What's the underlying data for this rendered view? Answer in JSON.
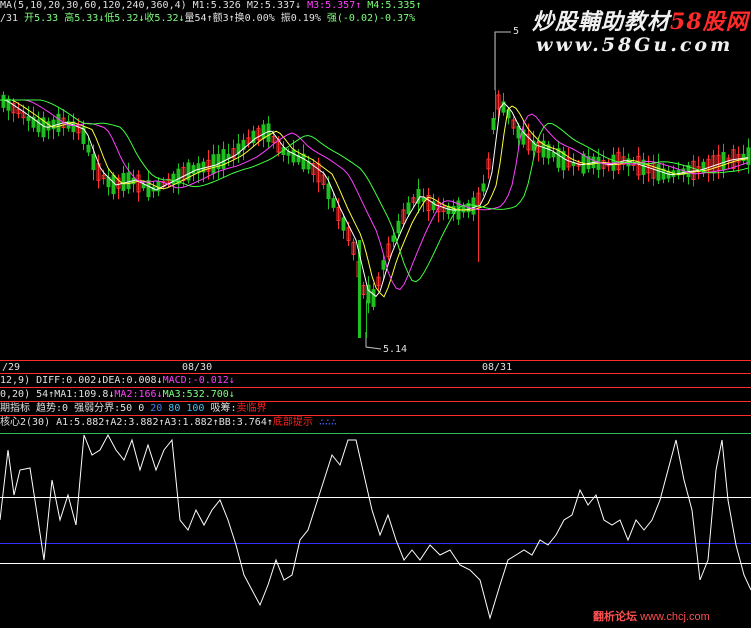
{
  "header": {
    "ma_line": [
      {
        "text": "MA(5,10,20,30,60,120,240,360,4) ",
        "color": "#e0e0e0"
      },
      {
        "text": "M1:5.326 ",
        "color": "#e0e0e0"
      },
      {
        "text": "M2:5.337↓ ",
        "color": "#e0e0e0"
      },
      {
        "text": "M3:5.357↑ ",
        "color": "#ff40ff"
      },
      {
        "text": "M4:5.335↑",
        "color": "#7cff7c"
      }
    ],
    "quote_line": [
      {
        "text": "/31 ",
        "color": "#e0e0e0"
      },
      {
        "text": "开5.33 ",
        "color": "#7cff7c"
      },
      {
        "text": "高5.33↓",
        "color": "#7cff7c"
      },
      {
        "text": "低5.32↓",
        "color": "#7cff7c"
      },
      {
        "text": "收5.32↓",
        "color": "#7cff7c"
      },
      {
        "text": "量54↑",
        "color": "#e0e0e0"
      },
      {
        "text": "额3↑",
        "color": "#e0e0e0"
      },
      {
        "text": "换0.00% ",
        "color": "#e0e0e0"
      },
      {
        "text": "振0.19% ",
        "color": "#e0e0e0"
      },
      {
        "text": "强(-0.02)-0.37%",
        "color": "#7cff7c"
      }
    ]
  },
  "watermark": {
    "brand_cn": "炒股輔助教材",
    "brand_58": "58股网",
    "url": "www.58Gu.com",
    "colors": {
      "brand_cn": "#f0f0f0",
      "brand_58": "#ff2a2a",
      "url": "#f0f0f0"
    }
  },
  "price_labels": {
    "high": "5",
    "low": "5.14"
  },
  "dates": [
    "/29",
    "08/30",
    "08/31"
  ],
  "indicators": [
    [
      {
        "text": " 12,9) ",
        "color": "#e0e0e0"
      },
      {
        "text": "DIFF:0.002↓",
        "color": "#e0e0e0"
      },
      {
        "text": "DEA:0.008↓",
        "color": "#e0e0e0"
      },
      {
        "text": "MACD:-0.012↓",
        "color": "#ff40ff"
      }
    ],
    [
      {
        "text": "0,20) ",
        "color": "#e0e0e0"
      },
      {
        "text": "54↑",
        "color": "#e0e0e0"
      },
      {
        "text": "MA1:109.8↓",
        "color": "#e0e0e0"
      },
      {
        "text": "MA2:166↓",
        "color": "#ff40ff"
      },
      {
        "text": "MA3:532.700↓",
        "color": "#7cff7c"
      }
    ],
    [
      {
        "text": "期指标 ",
        "color": "#e0e0e0"
      },
      {
        "text": "趋势:0 ",
        "color": "#e0e0e0"
      },
      {
        "text": "强弱分界:50 ",
        "color": "#e0e0e0"
      },
      {
        "text": "0 ",
        "color": "#e0e0e0"
      },
      {
        "text": "20 ",
        "color": "#4080ff"
      },
      {
        "text": "80 ",
        "color": "#40c0ff"
      },
      {
        "text": "100 ",
        "color": "#40c0ff"
      },
      {
        "text": "吸筹:",
        "color": "#e0e0e0"
      },
      {
        "text": "卖临界",
        "color": "#ff2020"
      }
    ],
    [
      {
        "text": "核心2(30) ",
        "color": "#e0e0e0"
      },
      {
        "text": "A1:5.882↑",
        "color": "#e0e0e0"
      },
      {
        "text": "A2:3.882↑",
        "color": "#e0e0e0"
      },
      {
        "text": "A3:1.882↑",
        "color": "#e0e0e0"
      },
      {
        "text": "BB:3.764↑",
        "color": "#e0e0e0"
      },
      {
        "text": "底部提示",
        "color": "#ff2020"
      },
      {
        "text": " ∴∴∴",
        "color": "#4060ff"
      }
    ]
  ],
  "footer": {
    "site_cn": "翻析论坛",
    "site_url": "www.chcj.com"
  },
  "colors": {
    "up": "#ff3030",
    "down": "#20c020",
    "panel_line": "#ff2a2a",
    "blue_level": "#3030ff"
  },
  "chart_data": {
    "type": "candlestick",
    "price_extremes": {
      "high": 5,
      "low": 5.14
    },
    "date_labels": [
      "/29",
      "08/30",
      "08/31"
    ],
    "indicator_levels": [
      0,
      20,
      50,
      80,
      100
    ]
  }
}
